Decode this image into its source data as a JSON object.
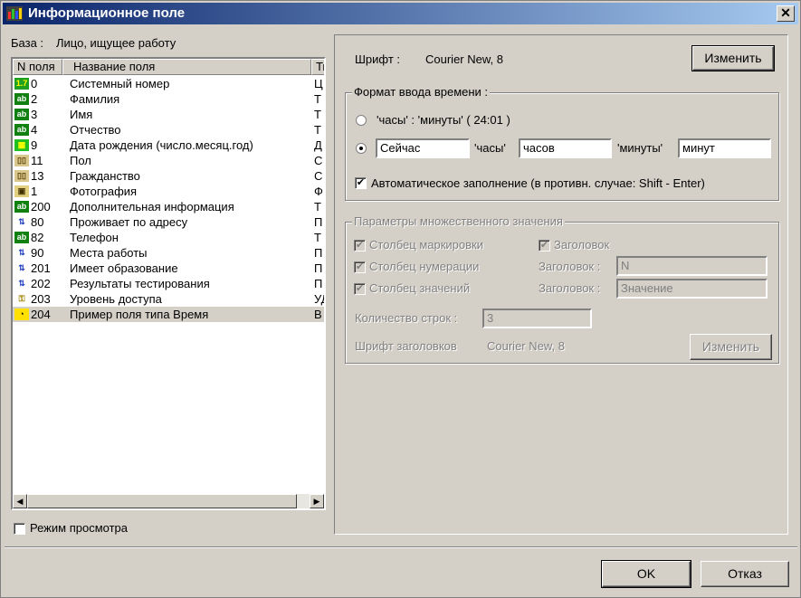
{
  "window": {
    "title": "Информационное поле",
    "close_glyph": "✕"
  },
  "base": {
    "label": "База :",
    "value": "Лицо, ищущее работу"
  },
  "list": {
    "columns": [
      "N поля",
      "Название поля",
      "Ти"
    ],
    "rows": [
      {
        "icon": "1.7",
        "num": "0",
        "name": "Системный номер",
        "type": "Ц"
      },
      {
        "icon": "ab",
        "num": "2",
        "name": "Фамилия",
        "type": "Т"
      },
      {
        "icon": "ab",
        "num": "3",
        "name": "Имя",
        "type": "Т"
      },
      {
        "icon": "ab",
        "num": "4",
        "name": "Отчество",
        "type": "Т"
      },
      {
        "icon": "date",
        "num": "9",
        "name": "Дата рождения (число.месяц.год)",
        "type": "Д"
      },
      {
        "icon": "book",
        "num": "11",
        "name": "Пол",
        "type": "С"
      },
      {
        "icon": "book",
        "num": "13",
        "name": "Гражданство",
        "type": "С"
      },
      {
        "icon": "photo",
        "num": "1",
        "name": "Фотография",
        "type": "Ф"
      },
      {
        "icon": "ab",
        "num": "200",
        "name": "Дополнительная информация",
        "type": "Т"
      },
      {
        "icon": "link",
        "num": "80",
        "name": "Проживает по адресу",
        "type": "П"
      },
      {
        "icon": "ab",
        "num": "82",
        "name": "Телефон",
        "type": "Т"
      },
      {
        "icon": "link",
        "num": "90",
        "name": "Места работы",
        "type": "П"
      },
      {
        "icon": "link",
        "num": "201",
        "name": "Имеет образование",
        "type": "П"
      },
      {
        "icon": "link",
        "num": "202",
        "name": "Результаты тестирования",
        "type": "П"
      },
      {
        "icon": "key",
        "num": "203",
        "name": "Уровень доступа",
        "type": "УД"
      },
      {
        "icon": "clock",
        "num": "204",
        "name": "Пример поля типа Время",
        "type": "В"
      }
    ],
    "selected_index": 15
  },
  "view_mode": {
    "label": "Режим просмотра",
    "checked": false
  },
  "font": {
    "label": "Шрифт :",
    "value": "Courier New, 8",
    "change_button": "Изменить"
  },
  "time_format": {
    "group_label": "Формат ввода времени :",
    "option1": "'часы' : 'минуты'  ( 24:01 )",
    "option2_field1": "Сейчас",
    "option2_label_hours": "'часы'",
    "option2_field2": "часов",
    "option2_label_minutes": "'минуты'",
    "option2_field3": "минут",
    "auto_fill": "Автоматическое заполнение (в противн. случае: Shift - Enter)",
    "auto_fill_checked": true
  },
  "multi_value": {
    "group_label": "Параметры множественного значения",
    "marking_column": "Столбец маркировки",
    "header": "Заголовок",
    "numbering_column": "Столбец нумерации",
    "numbering_header_label": "Заголовок :",
    "numbering_header_value": "N",
    "values_column": "Столбец значений",
    "values_header_label": "Заголовок :",
    "values_header_value": "Значение",
    "rows_count_label": "Количество строк :",
    "rows_count_value": "3",
    "header_font_label": "Шрифт заголовков",
    "header_font_value": "Courier New, 8",
    "change_button": "Изменить"
  },
  "footer": {
    "ok": "OK",
    "cancel": "Отказ"
  },
  "colors": {
    "title_start": "#0a246a",
    "title_end": "#a6caf0",
    "face": "#d4d0c8"
  }
}
